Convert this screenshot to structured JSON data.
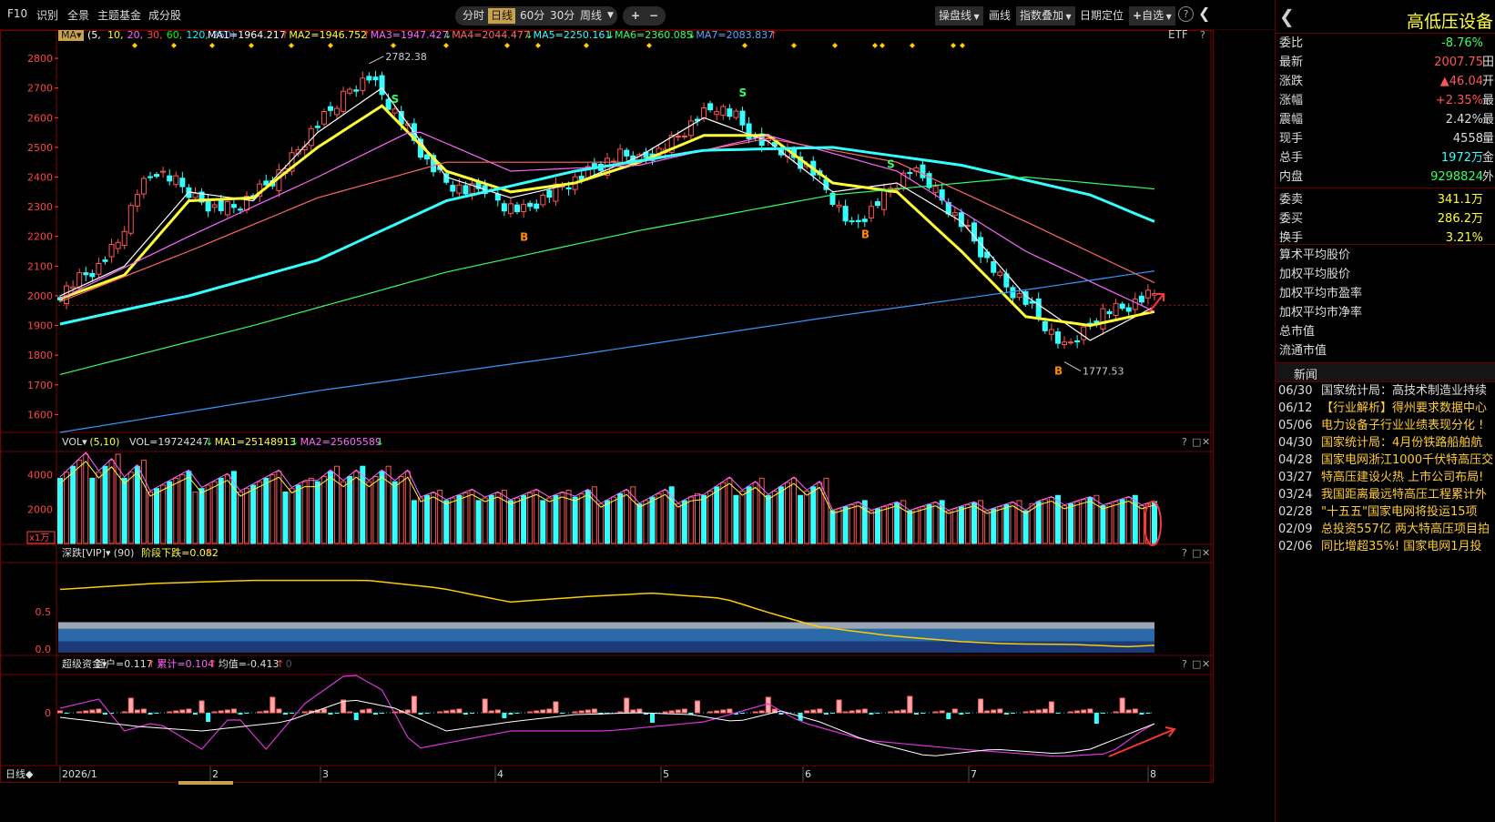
{
  "toolbar": {
    "left": [
      "F10",
      "识别",
      "全景",
      "主题基金",
      "成分股"
    ],
    "periods": [
      "分时",
      "日线",
      "60分",
      "30分",
      "周线"
    ],
    "period_active": "日线",
    "zoom_in": "+",
    "zoom_out": "−",
    "pan_label": "操盘线",
    "draw_label": "画线",
    "overlay_label": "指数叠加",
    "date_locate": "日期定位",
    "watch_label": "自选",
    "help": "?",
    "collapse": "❮"
  },
  "main_chart": {
    "indicator": "MA",
    "params_prefix": "(5,",
    "params": [
      "10,",
      "20,",
      "30,",
      "60,",
      "120,",
      "250)"
    ],
    "param_colors": [
      "#ffffff",
      "#ffff00",
      "#ff66ff",
      "#ff4444",
      "#00ff00",
      "#00ffff",
      "#3399ff"
    ],
    "ma_values": [
      {
        "text": "MA1=1964.217",
        "arrow": "↑",
        "color": "#ffffff"
      },
      {
        "text": "MA2=1946.752",
        "arrow": "↑",
        "color": "#ffff33"
      },
      {
        "text": "MA3=1947.427",
        "arrow": "↓",
        "color": "#ff66ff"
      },
      {
        "text": "MA4=2044.477",
        "arrow": "↓",
        "color": "#ff6666"
      },
      {
        "text": "MA5=2250.161",
        "arrow": "↓",
        "color": "#33ffff"
      },
      {
        "text": "MA6=2360.085",
        "arrow": "↓",
        "color": "#33ff66"
      },
      {
        "text": "MA7=2083.837",
        "arrow": "↑",
        "color": "#55aaff"
      }
    ],
    "etf": "ETF",
    "help": "?",
    "y_ticks": [
      "2800",
      "2700",
      "2600",
      "2500",
      "2400",
      "2300",
      "2200",
      "2100",
      "2000",
      "1900",
      "1800",
      "1700",
      "1600"
    ],
    "high_label": "2782.38",
    "low_label": "1777.53",
    "markers": [
      "S",
      "S",
      "S",
      "B",
      "B",
      "B"
    ]
  },
  "vol_panel": {
    "title": "VOL",
    "params": "(5,10)",
    "vol": "VOL=19724247",
    "vol_arrow": "↓",
    "ma1": "MA1=25148913",
    "ma1_arrow": "↓",
    "ma2": "MA2=25605589",
    "ma2_arrow": "↓",
    "y_ticks": [
      "4000",
      "2000"
    ],
    "unit": "x1万"
  },
  "sz_panel": {
    "title": "深跌[VIP]",
    "params": "(90)",
    "value": "阶段下跌=0.082",
    "value_arrow": "↑",
    "y_ticks": [
      "0.5",
      "0.0"
    ]
  },
  "fund_panel": {
    "title": "超级资金",
    "v1": "超户=0.117",
    "v1_arrow": "↑",
    "v2": "累计=0.104",
    "v2_arrow": "↑",
    "v3": "均值=-0.413",
    "v3_arrow": "↑",
    "v4": "0",
    "y_ticks": [
      "0"
    ]
  },
  "panel_ctrls": [
    "?",
    "□",
    "✕"
  ],
  "x_axis": {
    "mode": "日线◆",
    "labels": [
      "2026/1",
      "2",
      "3",
      "4",
      "5",
      "6",
      "7",
      "8"
    ]
  },
  "right_panel": {
    "title": "高低压设备",
    "rows": [
      {
        "label": "委比",
        "value": "-8.76%",
        "color": "#33ff66",
        "tail": ""
      },
      {
        "label": "最新",
        "value": "2007.75",
        "color": "#ff5555",
        "tail": "田"
      },
      {
        "label": "涨跌",
        "value": "▲46.04",
        "color": "#ff5555",
        "tail": "开"
      },
      {
        "label": "涨幅",
        "value": "+2.35%",
        "color": "#ff5555",
        "tail": "最"
      },
      {
        "label": "震幅",
        "value": "2.42%",
        "color": "#dddddd",
        "tail": "最"
      },
      {
        "label": "现手",
        "value": "4558",
        "color": "#dddddd",
        "tail": "量"
      },
      {
        "label": "总手",
        "value": "1972万",
        "color": "#33ffff",
        "tail": "金"
      },
      {
        "label": "内盘",
        "value": "9298824",
        "color": "#33ff66",
        "tail": "外"
      },
      {
        "label": "委卖",
        "value": "341.1万",
        "color": "#ffff33",
        "tail": ""
      },
      {
        "label": "委买",
        "value": "286.2万",
        "color": "#ffff33",
        "tail": ""
      },
      {
        "label": "换手",
        "value": "3.21%",
        "color": "#ffff33",
        "tail": ""
      }
    ],
    "stats": [
      "算术平均股价",
      "加权平均股价",
      "加权平均市盈率",
      "加权平均市净率",
      "总市值",
      "流通市值"
    ],
    "news_title": "新闻",
    "news": [
      {
        "date": "06/30",
        "text": "国家统计局：高技术制造业持续",
        "color": "#dddddd"
      },
      {
        "date": "06/12",
        "text": "【行业解析】得州要求数据中心",
        "color": "#ffcc33"
      },
      {
        "date": "05/06",
        "text": "电力设备子行业业绩表现分化 !",
        "color": "#ffcc33"
      },
      {
        "date": "04/30",
        "text": "国家统计局：4月份铁路船舶航",
        "color": "#ffcc33"
      },
      {
        "date": "04/28",
        "text": "国家电网浙江1000千伏特高压交",
        "color": "#ffcc33"
      },
      {
        "date": "03/27",
        "text": "特高压建设火热 上市公司布局!",
        "color": "#ffcc33"
      },
      {
        "date": "03/24",
        "text": "我国距离最远特高压工程累计外",
        "color": "#ffcc33"
      },
      {
        "date": "02/28",
        "text": "\"十五五\"国家电网将投运15项",
        "color": "#ffcc33"
      },
      {
        "date": "02/09",
        "text": "总投资557亿 两大特高压项目拍",
        "color": "#ffcc33"
      },
      {
        "date": "02/06",
        "text": "同比增超35%! 国家电网1月投",
        "color": "#ffcc33"
      }
    ]
  },
  "chart_data": {
    "type": "candlestick",
    "title": "高低压设备",
    "ylim": [
      1540,
      2840
    ],
    "x_labels": [
      "2026/1",
      "2",
      "3",
      "4",
      "5",
      "6",
      "7",
      "8"
    ],
    "y_ticks": [
      2800,
      2700,
      2600,
      2500,
      2400,
      2300,
      2200,
      2100,
      2000,
      1900,
      1800,
      1700,
      1600
    ],
    "close_path": [
      [
        0,
        2010
      ],
      [
        3,
        2060
      ],
      [
        6,
        2100
      ],
      [
        9,
        2180
      ],
      [
        12,
        2350
      ],
      [
        15,
        2420
      ],
      [
        18,
        2380
      ],
      [
        21,
        2330
      ],
      [
        24,
        2300
      ],
      [
        27,
        2300
      ],
      [
        30,
        2340
      ],
      [
        33,
        2390
      ],
      [
        36,
        2460
      ],
      [
        39,
        2550
      ],
      [
        42,
        2620
      ],
      [
        45,
        2700
      ],
      [
        48,
        2740
      ],
      [
        51,
        2650
      ],
      [
        54,
        2560
      ],
      [
        57,
        2450
      ],
      [
        60,
        2380
      ],
      [
        63,
        2350
      ],
      [
        66,
        2360
      ],
      [
        69,
        2310
      ],
      [
        72,
        2290
      ],
      [
        75,
        2330
      ],
      [
        78,
        2370
      ],
      [
        81,
        2400
      ],
      [
        84,
        2440
      ],
      [
        87,
        2470
      ],
      [
        90,
        2460
      ],
      [
        93,
        2490
      ],
      [
        96,
        2540
      ],
      [
        99,
        2600
      ],
      [
        102,
        2640
      ],
      [
        105,
        2600
      ],
      [
        108,
        2520
      ],
      [
        111,
        2500
      ],
      [
        114,
        2470
      ],
      [
        117,
        2420
      ],
      [
        120,
        2330
      ],
      [
        123,
        2230
      ],
      [
        126,
        2290
      ],
      [
        129,
        2360
      ],
      [
        132,
        2420
      ],
      [
        135,
        2380
      ],
      [
        138,
        2300
      ],
      [
        141,
        2220
      ],
      [
        144,
        2120
      ],
      [
        147,
        2030
      ],
      [
        150,
        1980
      ],
      [
        153,
        1900
      ],
      [
        156,
        1820
      ],
      [
        159,
        1880
      ],
      [
        162,
        1950
      ],
      [
        165,
        1960
      ],
      [
        168,
        1990
      ],
      [
        170,
        2007.75
      ]
    ],
    "high_point": 2782.38,
    "low_point": 1777.53,
    "last_close": 2007.75,
    "series": [
      {
        "name": "MA1",
        "color": "#ffffff",
        "values": [
          [
            0,
            2000
          ],
          [
            10,
            2100
          ],
          [
            20,
            2350
          ],
          [
            30,
            2320
          ],
          [
            40,
            2550
          ],
          [
            50,
            2700
          ],
          [
            60,
            2400
          ],
          [
            70,
            2330
          ],
          [
            80,
            2380
          ],
          [
            90,
            2470
          ],
          [
            100,
            2600
          ],
          [
            110,
            2520
          ],
          [
            120,
            2350
          ],
          [
            130,
            2380
          ],
          [
            140,
            2250
          ],
          [
            150,
            2000
          ],
          [
            160,
            1850
          ],
          [
            170,
            1964
          ]
        ]
      },
      {
        "name": "MA2",
        "color": "#ffff33",
        "values": [
          [
            0,
            1990
          ],
          [
            10,
            2070
          ],
          [
            20,
            2320
          ],
          [
            30,
            2330
          ],
          [
            40,
            2500
          ],
          [
            50,
            2640
          ],
          [
            60,
            2420
          ],
          [
            70,
            2350
          ],
          [
            80,
            2380
          ],
          [
            90,
            2450
          ],
          [
            100,
            2540
          ],
          [
            110,
            2540
          ],
          [
            120,
            2380
          ],
          [
            130,
            2350
          ],
          [
            140,
            2150
          ],
          [
            150,
            1930
          ],
          [
            160,
            1900
          ],
          [
            170,
            1947
          ]
        ]
      },
      {
        "name": "MA3",
        "color": "#ff66ff",
        "values": [
          [
            0,
            1990
          ],
          [
            20,
            2200
          ],
          [
            40,
            2400
          ],
          [
            55,
            2560
          ],
          [
            70,
            2420
          ],
          [
            90,
            2440
          ],
          [
            110,
            2540
          ],
          [
            130,
            2420
          ],
          [
            150,
            2150
          ],
          [
            170,
            1947
          ]
        ]
      },
      {
        "name": "MA4",
        "color": "#ff6666",
        "values": [
          [
            0,
            1980
          ],
          [
            20,
            2150
          ],
          [
            40,
            2330
          ],
          [
            60,
            2450
          ],
          [
            90,
            2450
          ],
          [
            110,
            2530
          ],
          [
            130,
            2450
          ],
          [
            150,
            2250
          ],
          [
            170,
            2044
          ]
        ]
      },
      {
        "name": "MA5",
        "color": "#33ffff",
        "values": [
          [
            0,
            1905
          ],
          [
            20,
            2000
          ],
          [
            40,
            2120
          ],
          [
            60,
            2320
          ],
          [
            80,
            2420
          ],
          [
            100,
            2490
          ],
          [
            120,
            2500
          ],
          [
            140,
            2440
          ],
          [
            160,
            2340
          ],
          [
            170,
            2250
          ]
        ]
      },
      {
        "name": "MA6",
        "color": "#33ff66",
        "values": [
          [
            0,
            1735
          ],
          [
            30,
            1900
          ],
          [
            60,
            2080
          ],
          [
            90,
            2220
          ],
          [
            120,
            2340
          ],
          [
            150,
            2400
          ],
          [
            170,
            2360
          ]
        ]
      },
      {
        "name": "MA7",
        "color": "#3399ff",
        "values": [
          [
            0,
            1540
          ],
          [
            40,
            1680
          ],
          [
            80,
            1800
          ],
          [
            120,
            1930
          ],
          [
            150,
            2020
          ],
          [
            170,
            2084
          ]
        ]
      }
    ]
  }
}
